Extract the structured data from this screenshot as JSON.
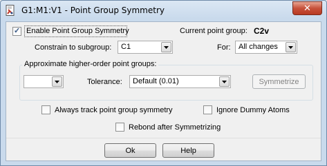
{
  "window": {
    "title": "G1:M1:V1 - Point Group Symmetry",
    "close_glyph": "✕"
  },
  "enable_symmetry": {
    "label": "Enable Point Group Symmetry",
    "checked": true
  },
  "current_point_group": {
    "label": "Current point group:",
    "value": "C2v"
  },
  "constrain": {
    "label": "Constrain to subgroup:",
    "value": "C1"
  },
  "for": {
    "label": "For:",
    "value": "All changes"
  },
  "approx_group": {
    "label": "Approximate higher-order point groups:",
    "group_value": "",
    "tolerance_label": "Tolerance:",
    "tolerance_value": "Default (0.01)",
    "symmetrize_label": "Symmetrize"
  },
  "options": {
    "always_track": {
      "label": "Always track point group symmetry",
      "checked": false
    },
    "ignore_dummy": {
      "label": "Ignore Dummy Atoms",
      "checked": false
    },
    "rebond": {
      "label": "Rebond after Symmetrizing",
      "checked": false
    }
  },
  "buttons": {
    "ok": "Ok",
    "help": "Help"
  },
  "icons": {
    "app": "gaussview-doc-icon",
    "close": "close-icon",
    "dropdown": "chevron-down-icon",
    "check": "checkmark-icon"
  },
  "colors": {
    "close_red": "#c7513a",
    "title_blue": "#c9daec"
  }
}
